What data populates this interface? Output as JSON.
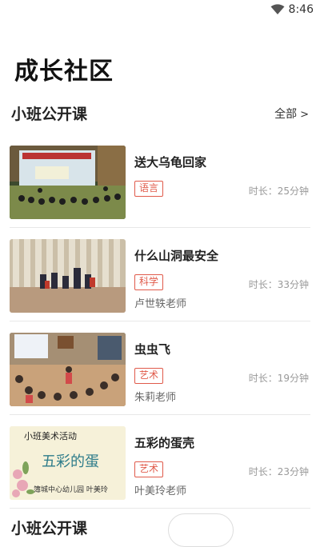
{
  "status_bar": {
    "time": "8:46",
    "icon": "wifi-icon"
  },
  "page": {
    "title": "成长社区"
  },
  "section": {
    "title": "小班公开课",
    "see_all_label": "全部",
    "see_all_icon": "chevron-right-icon"
  },
  "courses": [
    {
      "title": "送大乌龟回家",
      "tag": "语言",
      "teacher": "",
      "duration": "时长：25分钟"
    },
    {
      "title": "什么山洞最安全",
      "tag": "科学",
      "teacher": "卢世轶老师",
      "duration": "时长：33分钟"
    },
    {
      "title": "虫虫飞",
      "tag": "艺术",
      "teacher": "朱莉老师",
      "duration": "时长：19分钟"
    },
    {
      "title": "五彩的蛋壳",
      "tag": "艺术",
      "teacher": "叶美玲老师",
      "duration": "时长：23分钟"
    }
  ],
  "thumb4_text": {
    "line1": "小班美术活动",
    "line2": "五彩的蛋",
    "line3": "簿城中心幼儿园   叶美玲"
  },
  "next_section": {
    "title": "小班公开课"
  },
  "colors": {
    "tag_red": "#e05a4a",
    "divider": "#e8e8e8",
    "muted": "#999999"
  }
}
